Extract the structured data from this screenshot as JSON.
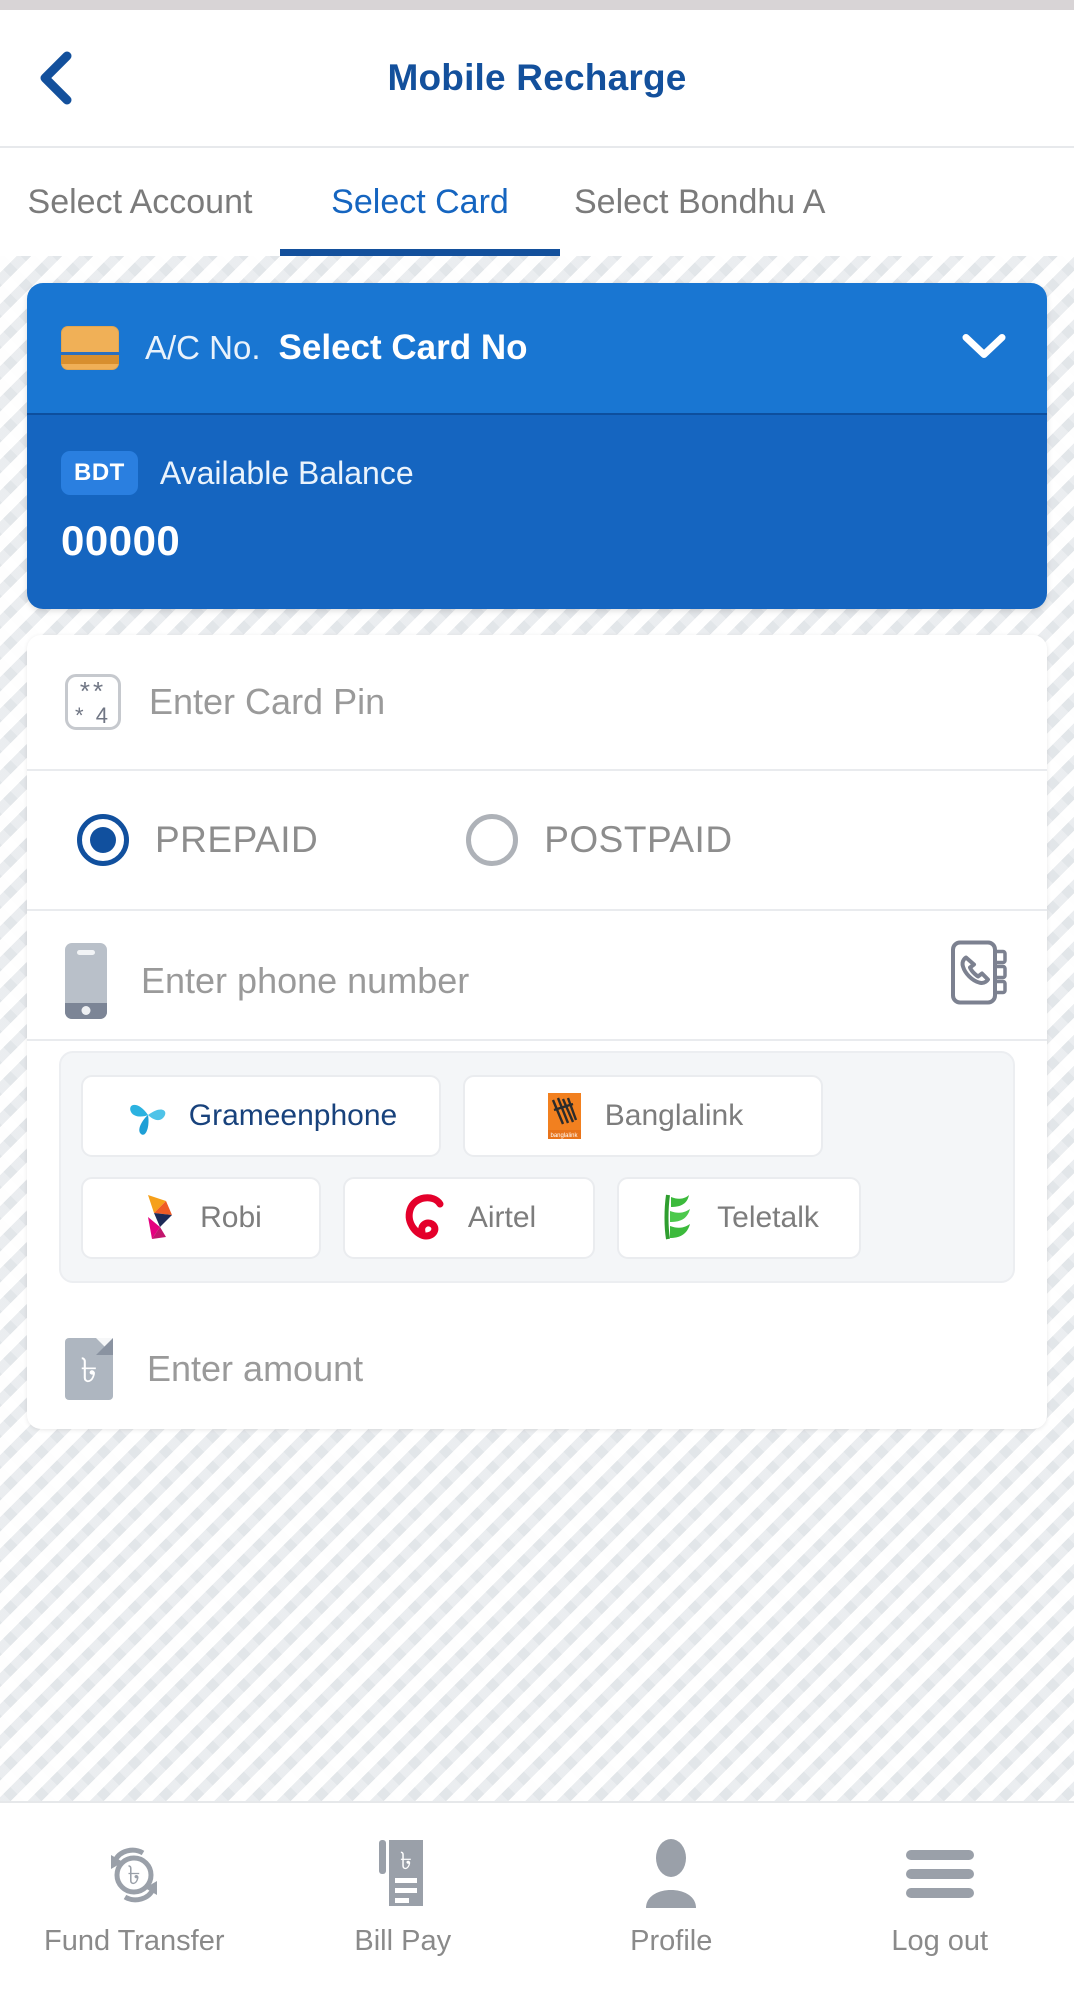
{
  "header": {
    "title": "Mobile Recharge",
    "back_icon": "chevron-left-icon"
  },
  "tabs": [
    {
      "label": "Select Account",
      "active": false
    },
    {
      "label": "Select Card",
      "active": true
    },
    {
      "label": "Select Bondhu A",
      "active": false
    }
  ],
  "account_card": {
    "card_icon": "credit-card-icon",
    "ac_label": "A/C No.",
    "ac_value": "Select Card No",
    "chevron_icon": "chevron-down-icon",
    "currency_badge": "BDT",
    "balance_label": "Available Balance",
    "balance_value": "00000"
  },
  "form": {
    "pin": {
      "icon": "pin-keypad-icon",
      "icon_row1": "**",
      "icon_row2": "* 4",
      "placeholder": "Enter Card Pin",
      "value": ""
    },
    "plan": {
      "options": [
        {
          "label": "PREPAID",
          "selected": true
        },
        {
          "label": "POSTPAID",
          "selected": false
        }
      ]
    },
    "phone": {
      "icon": "smartphone-icon",
      "placeholder": "Enter phone number",
      "value": "",
      "contacts_icon": "contact-book-icon"
    },
    "operators": [
      [
        {
          "name": "Grameenphone",
          "logo": "grameenphone-logo"
        },
        {
          "name": "Banglalink",
          "logo": "banglalink-logo"
        }
      ],
      [
        {
          "name": "Robi",
          "logo": "robi-logo"
        },
        {
          "name": "Airtel",
          "logo": "airtel-logo"
        },
        {
          "name": "Teletalk",
          "logo": "teletalk-logo"
        }
      ]
    ],
    "amount": {
      "icon": "taka-document-icon",
      "placeholder": "Enter amount",
      "value": ""
    }
  },
  "bottom_nav": [
    {
      "label": "Fund Transfer",
      "icon": "fund-transfer-icon"
    },
    {
      "label": "Bill Pay",
      "icon": "bill-pay-icon"
    },
    {
      "label": "Profile",
      "icon": "profile-icon"
    },
    {
      "label": "Log out",
      "icon": "hamburger-menu-icon"
    }
  ],
  "colors": {
    "brand_blue": "#13509c",
    "card_blue_top": "#1976d2",
    "card_blue_bottom": "#1565c0",
    "accent_tab": "#1565c0",
    "muted_text": "#8a8a8a"
  }
}
